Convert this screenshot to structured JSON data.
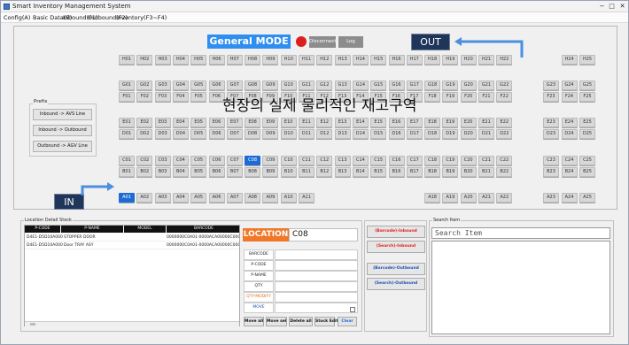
{
  "window": {
    "title": "Smart Inventory Management System",
    "minimize": "−",
    "maximize": "□",
    "close": "✕"
  },
  "menu": [
    "Config(A)",
    "Basic Data(B)",
    "Inbound(F1)",
    "Outbound(F2)",
    "Inventory(F3~F4)"
  ],
  "main": {
    "mode_label": "General MODE",
    "disconnect_label": "Disconnect",
    "log_label": "Log",
    "out_label": "OUT",
    "in_label": "IN"
  },
  "overlay_title": "현장의 실제 물리적인 재고구역",
  "prefix": {
    "title": "Prefix",
    "buttons": [
      "Inbound -> AVS Line",
      "Inbound -> Outbound",
      "Outbound -> AGV Line"
    ]
  },
  "rows": [
    {
      "prefix": "H",
      "row": 0,
      "cells": [
        "H01",
        "H02",
        "H03",
        "H04",
        "H05",
        "H06",
        "H07",
        "H08",
        "H09",
        "H10",
        "H11",
        "H12",
        "H13",
        "H14",
        "H15",
        "H16",
        "H17",
        "H18",
        "H19",
        "H20",
        "H21",
        "H22",
        "H23",
        "H24",
        "H25"
      ],
      "skip": [
        22
      ],
      "sel": []
    },
    {
      "prefix": "G",
      "row": 1,
      "cells": [
        "G01",
        "G02",
        "G03",
        "G04",
        "G05",
        "G06",
        "G07",
        "G08",
        "G09",
        "G10",
        "G11",
        "G12",
        "G13",
        "G14",
        "G15",
        "G16",
        "G17",
        "G18",
        "G19",
        "G20",
        "G21",
        "G22",
        "G23",
        "G24",
        "G25"
      ],
      "skip": [],
      "sel": []
    },
    {
      "prefix": "F",
      "row": 2,
      "cells": [
        "F01",
        "F02",
        "F03",
        "F04",
        "F05",
        "F06",
        "F07",
        "F08",
        "F09",
        "F10",
        "F11",
        "F12",
        "F13",
        "F14",
        "F15",
        "F16",
        "F17",
        "F18",
        "F19",
        "F20",
        "F21",
        "F22",
        "F23",
        "F24",
        "F25"
      ],
      "skip": [],
      "sel": []
    },
    {
      "prefix": "E",
      "row": 3,
      "cells": [
        "E01",
        "E02",
        "E03",
        "E04",
        "E05",
        "E06",
        "E07",
        "E08",
        "E09",
        "E10",
        "E11",
        "E12",
        "E13",
        "E14",
        "E15",
        "E16",
        "E17",
        "E18",
        "E19",
        "E20",
        "E21",
        "E22",
        "E23",
        "E24",
        "E25"
      ],
      "skip": [],
      "sel": []
    },
    {
      "prefix": "D",
      "row": 4,
      "cells": [
        "D01",
        "D02",
        "D03",
        "D04",
        "D05",
        "D06",
        "D07",
        "D08",
        "D09",
        "D10",
        "D11",
        "D12",
        "D13",
        "D14",
        "D15",
        "D16",
        "D17",
        "D18",
        "D19",
        "D20",
        "D21",
        "D22",
        "D23",
        "D24",
        "D25"
      ],
      "skip": [],
      "sel": []
    },
    {
      "prefix": "C",
      "row": 5,
      "cells": [
        "C01",
        "C02",
        "C03",
        "C04",
        "C05",
        "C06",
        "C07",
        "C08",
        "C09",
        "C10",
        "C11",
        "C12",
        "C13",
        "C14",
        "C15",
        "C16",
        "C17",
        "C18",
        "C19",
        "C20",
        "C21",
        "C22",
        "C23",
        "C24",
        "C25"
      ],
      "skip": [],
      "sel": [
        7
      ]
    },
    {
      "prefix": "B",
      "row": 6,
      "cells": [
        "B01",
        "B02",
        "B03",
        "B04",
        "B05",
        "B06",
        "B07",
        "B08",
        "B09",
        "B10",
        "B11",
        "B12",
        "B13",
        "B14",
        "B15",
        "B16",
        "B17",
        "B18",
        "B19",
        "B20",
        "B21",
        "B22",
        "B23",
        "B24",
        "B25"
      ],
      "skip": [],
      "sel": []
    },
    {
      "prefix": "A",
      "row": 7,
      "cells": [
        "A01",
        "A02",
        "A03",
        "A04",
        "A05",
        "A06",
        "A07",
        "A08",
        "A09",
        "A10",
        "A11",
        "A12",
        "A13",
        "A14",
        "A15",
        "A16",
        "A17",
        "A18",
        "A19",
        "A20",
        "A21",
        "A22",
        "A23",
        "A24",
        "A25"
      ],
      "skip": [
        11,
        12,
        13,
        14,
        15,
        16
      ],
      "sel": [
        0
      ]
    }
  ],
  "stock": {
    "group_label": "Location Detail Stock",
    "headers": [
      "P-CODE",
      "P-NAME",
      "MODEL",
      "BARCODE"
    ],
    "rows": [
      [
        "D4E1-D5D10A000",
        "STOPPER DOOR",
        "",
        "0000000C0A01-0000ACA00000C000000"
      ],
      [
        "D4E1-D5D10A000",
        "Door TRAY ASY",
        "",
        "0000000C0A01-0000ACA00000C000000"
      ]
    ]
  },
  "location": {
    "label": "LOCATION",
    "value": "C08",
    "fields": [
      "BARCODE",
      "P-CODE",
      "P-NAME",
      "QTY",
      "QTY-MODIFY",
      "MOVE"
    ],
    "buttons": [
      "Move all",
      "Move sel",
      "Delete all",
      "Stock Edit",
      "Clear"
    ]
  },
  "actions": [
    "(Barcode)-Inbound",
    "(Search)-Inbound",
    "(Barcode)-Outbound",
    "(Search)-Outbound"
  ],
  "search": {
    "group_label": "Search Item",
    "placeholder": "Search Item"
  },
  "colors": {
    "accent_blue": "#2f8ff0",
    "selected_cell": "#1e6bd6",
    "status_red": "#dd1e1e",
    "location_orange": "#f07828",
    "dock_navy": "#1f3559",
    "inbound_red": "#e02020",
    "outbound_blue": "#1e50b4"
  }
}
